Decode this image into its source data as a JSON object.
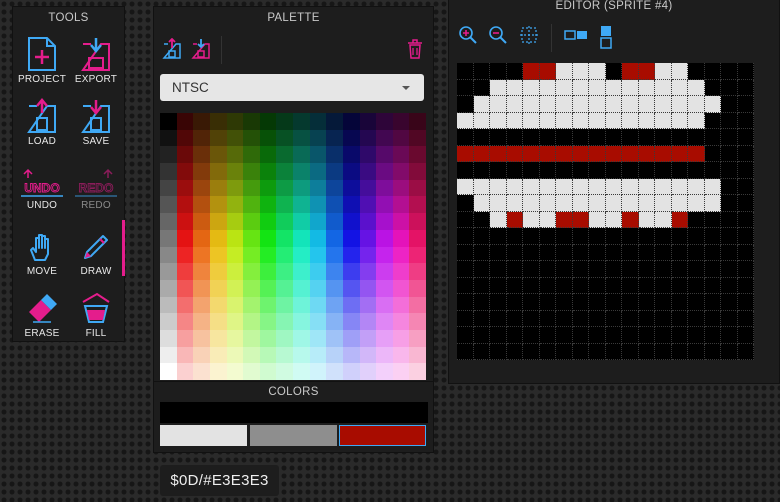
{
  "tools": {
    "title": "TOOLS",
    "items": [
      {
        "label": "PROJECT",
        "icon": "new-project-icon"
      },
      {
        "label": "EXPORT",
        "icon": "export-icon"
      },
      {
        "label": "LOAD",
        "icon": "load-icon"
      },
      {
        "label": "SAVE",
        "icon": "save-icon"
      },
      {
        "label": "UNDO",
        "icon": "undo-icon",
        "icon_text": "UNDO"
      },
      {
        "label": "REDO",
        "icon": "redo-icon",
        "icon_text": "REDO"
      },
      {
        "label": "MOVE",
        "icon": "hand-icon"
      },
      {
        "label": "DRAW",
        "icon": "pencil-icon"
      },
      {
        "label": "ERASE",
        "icon": "eraser-icon"
      },
      {
        "label": "FILL",
        "icon": "bucket-icon"
      }
    ]
  },
  "palette": {
    "title": "PALETTE",
    "selected_palette": "NTSC",
    "toolbar_icons": [
      "import-palette-icon",
      "export-palette-icon",
      "trash-icon"
    ]
  },
  "colors": {
    "title": "COLORS",
    "background": "#000000",
    "swatches": [
      "#E3E3E3",
      "#8E8E8E",
      "#A80C00"
    ],
    "selected_swatch": 2
  },
  "status": {
    "text": "$0D/#E3E3E3"
  },
  "editor": {
    "title": "EDITOR (SPRITE #4)",
    "toolbar_icons": [
      "zoom-in-icon",
      "zoom-out-icon",
      "grid-icon",
      "flip-horizontal-icon",
      "flip-vertical-icon"
    ],
    "colors": {
      "0": "#000000",
      "1": "#E3E3E3",
      "3": "#A80C00"
    },
    "pixels": [
      "000233111233110000",
      "001111111111111000",
      "011111111111111100",
      "111111111111111000",
      "000000000000000000",
      "333333333333333000",
      "000000000000000000",
      "111111111111111100",
      "011111111111111100",
      "001311331131130000",
      "000000000000000000",
      "000000000000000000",
      "000000000000000000",
      "000000000000000000",
      "000000000000000000",
      "000000000000000000",
      "000000000000000000",
      "000000000000000000"
    ]
  },
  "accent": "#e41d8c",
  "tool_blue": "#3fa9f5"
}
